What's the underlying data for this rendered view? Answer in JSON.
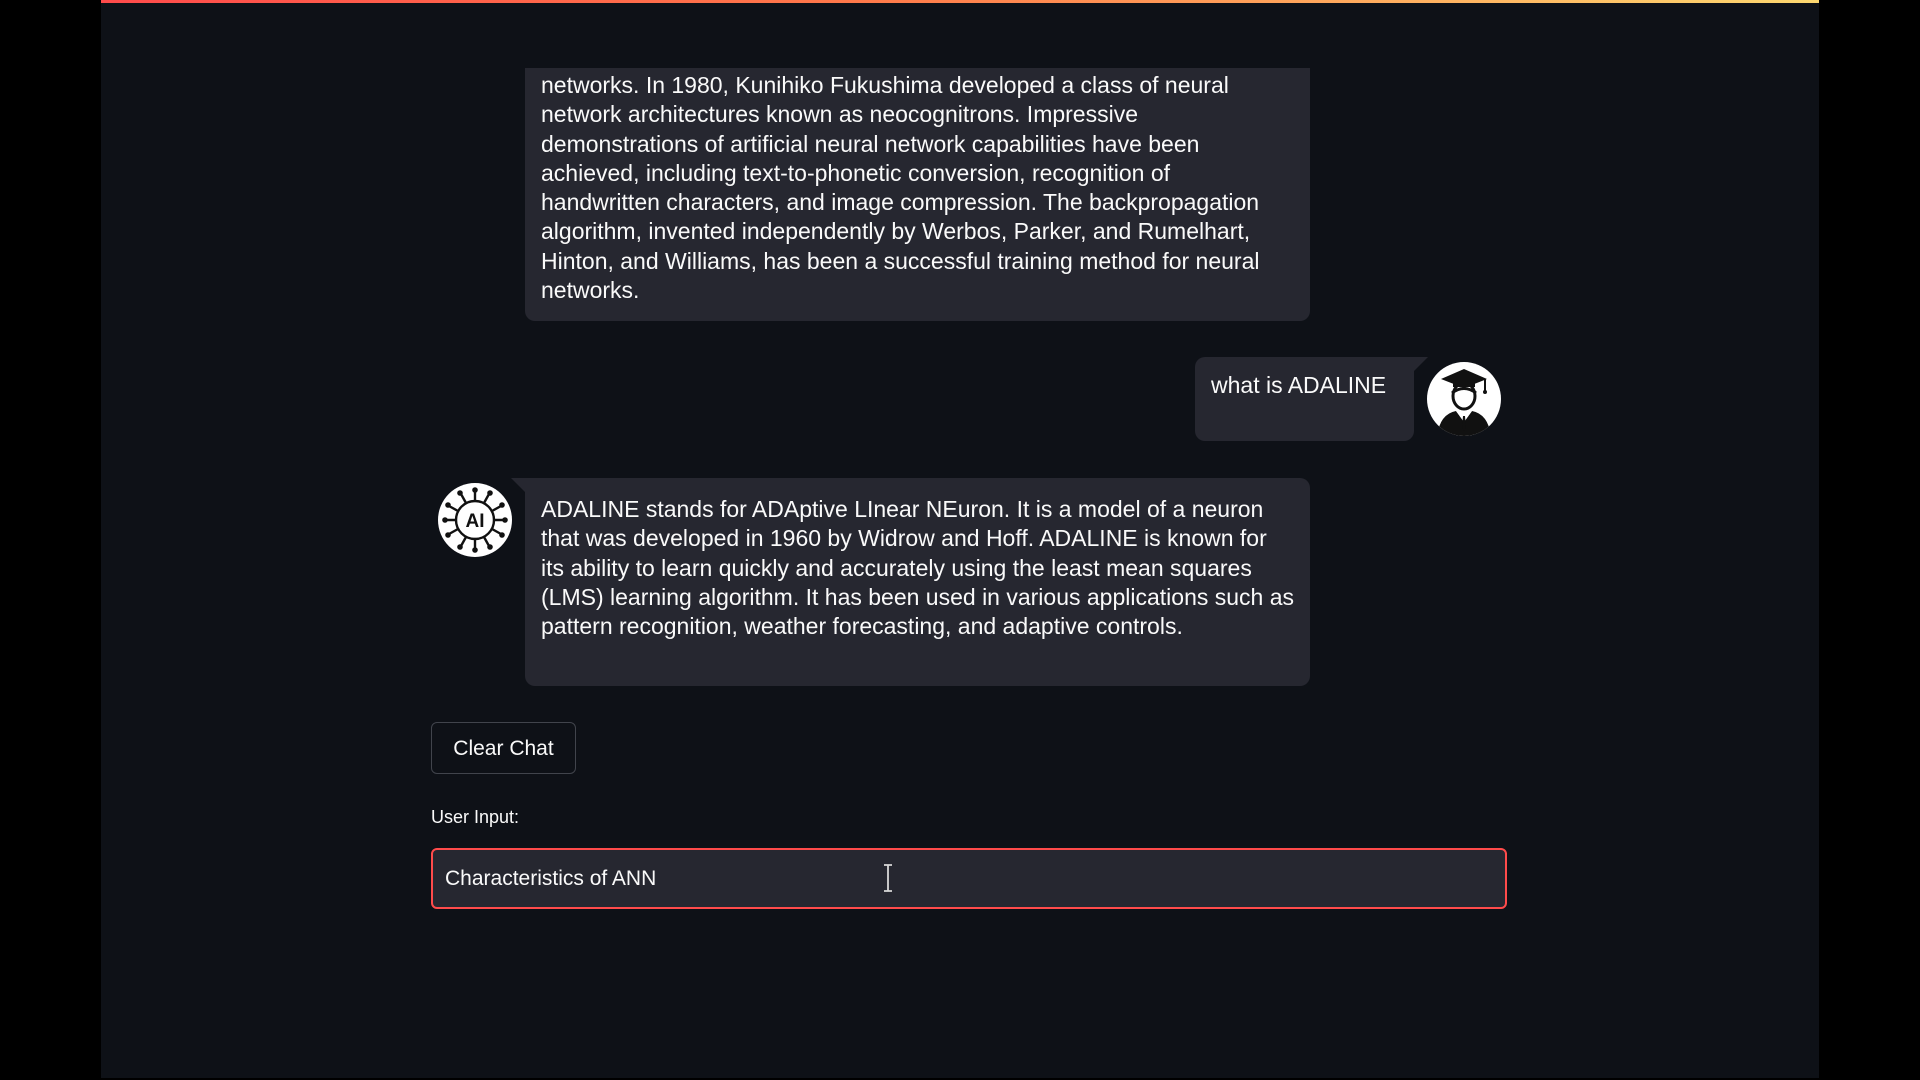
{
  "colors": {
    "background": "#0e1117",
    "bubble": "#262730",
    "text": "#fafafa",
    "accent": "#ff4b4b"
  },
  "chat": {
    "messages": [
      {
        "role": "assistant",
        "text": "networks. In 1980, Kunihiko Fukushima developed a class of neural network architectures known as neocognitrons. Impressive demonstrations of artificial neural network capabilities have been achieved, including text-to-phonetic conversion, recognition of handwritten characters, and image compression. The backpropagation algorithm, invented independently by Werbos, Parker, and Rumelhart, Hinton, and Williams, has been a successful training method for neural networks."
      },
      {
        "role": "user",
        "avatar_icon": "graduate-student-icon",
        "text": "what is ADALINE"
      },
      {
        "role": "assistant",
        "avatar_icon": "ai-chip-icon",
        "avatar_text": "AI",
        "text": "ADALINE stands for ADAptive LInear NEuron. It is a model of a neuron that was developed in 1960 by Widrow and Hoff. ADALINE is known for its ability to learn quickly and accurately using the least mean squares (LMS) learning algorithm. It has been used in various applications such as pattern recognition, weather forecasting, and adaptive controls."
      }
    ]
  },
  "controls": {
    "clear_label": "Clear Chat",
    "input_label": "User Input:",
    "input_value": "Characteristics of ANN"
  }
}
